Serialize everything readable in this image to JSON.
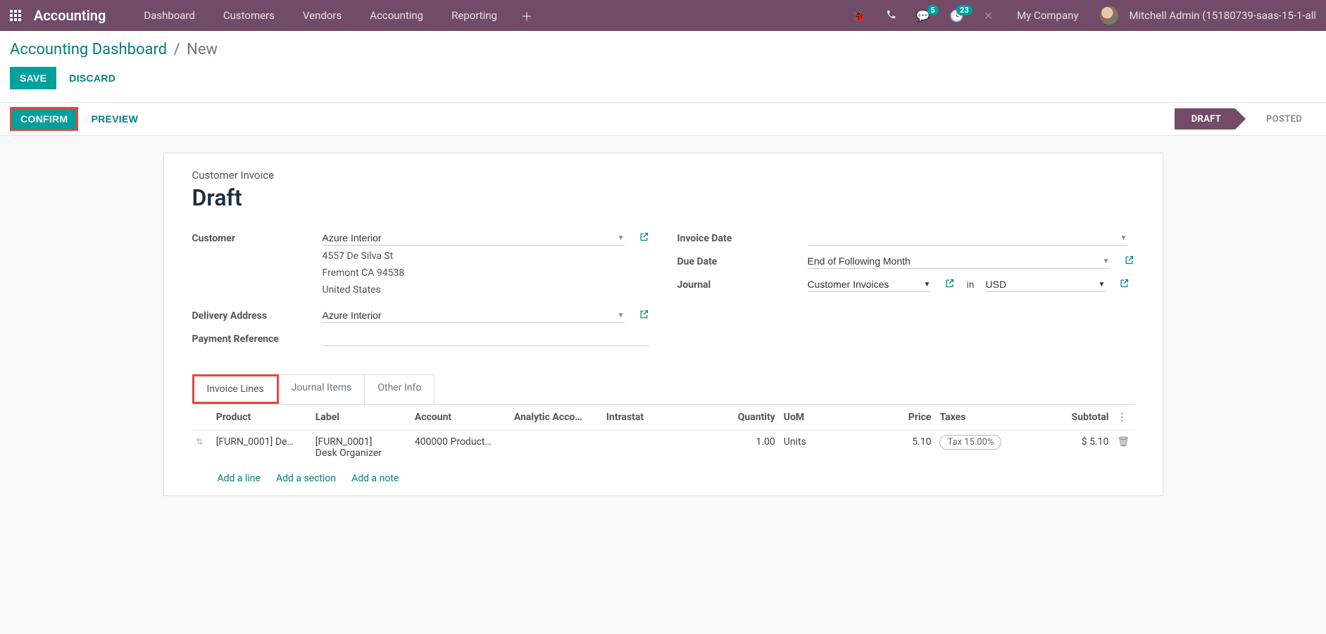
{
  "header": {
    "app": "Accounting",
    "menu": [
      "Dashboard",
      "Customers",
      "Vendors",
      "Accounting",
      "Reporting"
    ],
    "messages_count": "5",
    "activities_count": "23",
    "company": "My Company",
    "user": "Mitchell Admin (15180739-saas-15-1-all"
  },
  "breadcrumbs": {
    "root": "Accounting Dashboard",
    "current": "New"
  },
  "actions": {
    "save": "SAVE",
    "discard": "DISCARD",
    "confirm": "CONFIRM",
    "preview": "PREVIEW"
  },
  "status": {
    "draft": "DRAFT",
    "posted": "POSTED"
  },
  "form": {
    "title_label": "Customer Invoice",
    "title": "Draft",
    "labels": {
      "customer": "Customer",
      "delivery_address": "Delivery Address",
      "payment_reference": "Payment Reference",
      "invoice_date": "Invoice Date",
      "due_date": "Due Date",
      "journal": "Journal",
      "in": "in"
    },
    "customer": "Azure Interior",
    "address_line1": "4557 De Silva St",
    "address_line2": "Fremont CA 94538",
    "address_line3": "United States",
    "delivery_address": "Azure Interior",
    "payment_reference": "",
    "invoice_date": "",
    "due_date": "End of Following Month",
    "journal": "Customer Invoices",
    "currency": "USD"
  },
  "tabs": {
    "invoice_lines": "Invoice Lines",
    "journal_items": "Journal Items",
    "other_info": "Other Info"
  },
  "table": {
    "headers": {
      "product": "Product",
      "label": "Label",
      "account": "Account",
      "analytic": "Analytic Acco…",
      "intrastat": "Intrastat",
      "quantity": "Quantity",
      "uom": "UoM",
      "price": "Price",
      "taxes": "Taxes",
      "subtotal": "Subtotal"
    },
    "row": {
      "product": "[FURN_0001] De…",
      "label_l1": "[FURN_0001]",
      "label_l2": "Desk Organizer",
      "account": "400000 Product…",
      "analytic": "",
      "intrastat": "",
      "quantity": "1.00",
      "uom": "Units",
      "price": "5.10",
      "tax": "Tax 15.00%",
      "subtotal": "$ 5.10"
    },
    "add": {
      "line": "Add a line",
      "section": "Add a section",
      "note": "Add a note"
    }
  }
}
